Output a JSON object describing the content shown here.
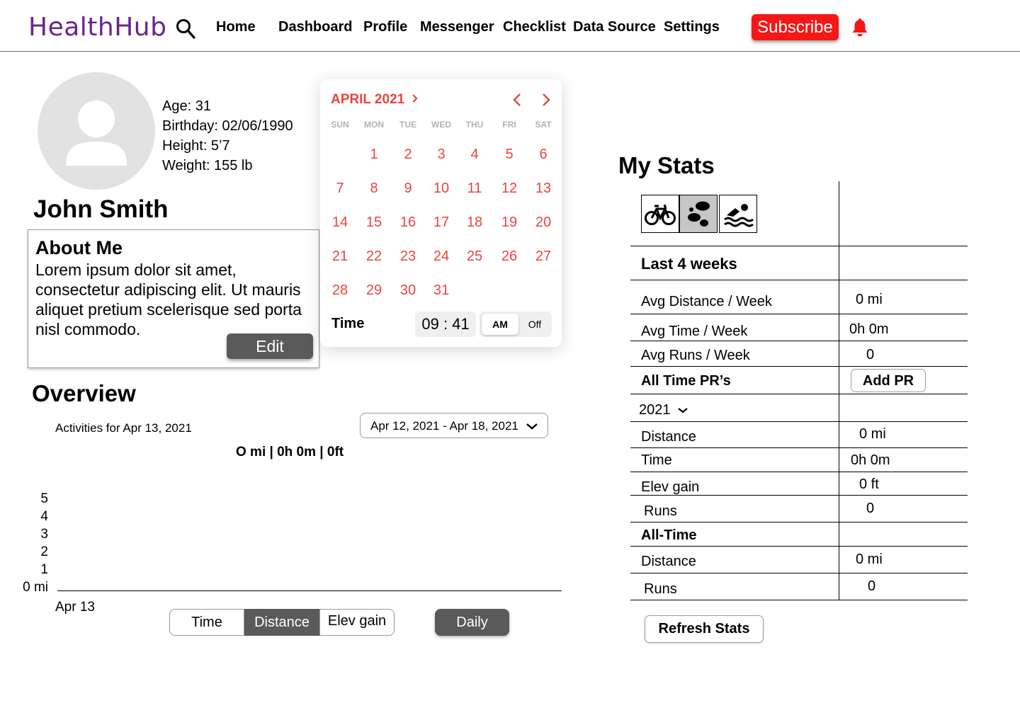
{
  "nav": {
    "logo": "HealthHub",
    "links": [
      "Home",
      "Dashboard",
      "Profile",
      "Messenger",
      "Checklist",
      "Data Source",
      "Settings"
    ],
    "subscribe": "Subscribe",
    "colors": {
      "brand": "#6a2490",
      "subscribe": "#f51717",
      "bell": "#f51717"
    }
  },
  "profile": {
    "info": [
      "Age: 31",
      "Birthday: 02/06/1990",
      "Height: 5’7",
      "Weight: 155 lb"
    ],
    "name": "John Smith",
    "about_title": "About Me",
    "about_text": "Lorem ipsum dolor sit amet, consectetur adipiscing elit. Ut mauris aliquet pretium scelerisque sed porta nisl commodo.",
    "edit": "Edit"
  },
  "calendar": {
    "month": "APRIL 2021",
    "weekdays": [
      "SUN",
      "MON",
      "TUE",
      "WED",
      "THU",
      "FRI",
      "SAT"
    ],
    "days": [
      "1",
      "2",
      "3",
      "4",
      "5",
      "6",
      "7",
      "8",
      "9",
      "10",
      "11",
      "12",
      "13",
      "14",
      "15",
      "16",
      "17",
      "18",
      "19",
      "20",
      "21",
      "22",
      "23",
      "24",
      "25",
      "26",
      "27",
      "28",
      "29",
      "30",
      "31"
    ],
    "time_label": "Time",
    "time_value": "09 : 41",
    "am": "AM",
    "off": "Off",
    "accent": "#e9453d"
  },
  "overview": {
    "title": "Overview",
    "activities_for": "Activities for Apr 13, 2021",
    "date_range": "Apr 12, 2021 - Apr 18, 2021",
    "summary": "O mi | 0h 0m | 0ft",
    "tabs": [
      "Time",
      "Distance",
      "Elev gain"
    ],
    "active_tab": "Distance",
    "period": "Daily"
  },
  "chart_data": {
    "type": "bar",
    "categories": [
      "Apr 13"
    ],
    "values": [
      0
    ],
    "yticks": [
      "5",
      "4",
      "3",
      "2",
      "1",
      "0 mi"
    ],
    "ylim": [
      0,
      5
    ],
    "title": "",
    "xlabel": "",
    "ylabel": ""
  },
  "stats": {
    "title": "My Stats",
    "sports": [
      "bike-icon",
      "footprints-icon",
      "swim-icon"
    ],
    "active_sport": "footprints-icon",
    "last4_label": "Last 4 weeks",
    "last4_rows": [
      {
        "label": "Avg Distance / Week",
        "value": "0 mi"
      },
      {
        "label": "Avg Time / Week",
        "value": "0h 0m"
      },
      {
        "label": "Avg Runs / Week",
        "value": "0"
      }
    ],
    "pr_label": "All Time PR’s",
    "add_pr": "Add PR",
    "year": "2021",
    "year_rows": [
      {
        "label": "Distance",
        "value": "0 mi"
      },
      {
        "label": "Time",
        "value": "0h 0m"
      },
      {
        "label": "Elev gain",
        "value": "0 ft"
      },
      {
        "label": "Runs",
        "value": "0"
      }
    ],
    "alltime_label": "All-Time",
    "alltime_rows": [
      {
        "label": "Distance",
        "value": "0 mi"
      },
      {
        "label": "Runs",
        "value": "0"
      }
    ],
    "refresh": "Refresh Stats"
  }
}
